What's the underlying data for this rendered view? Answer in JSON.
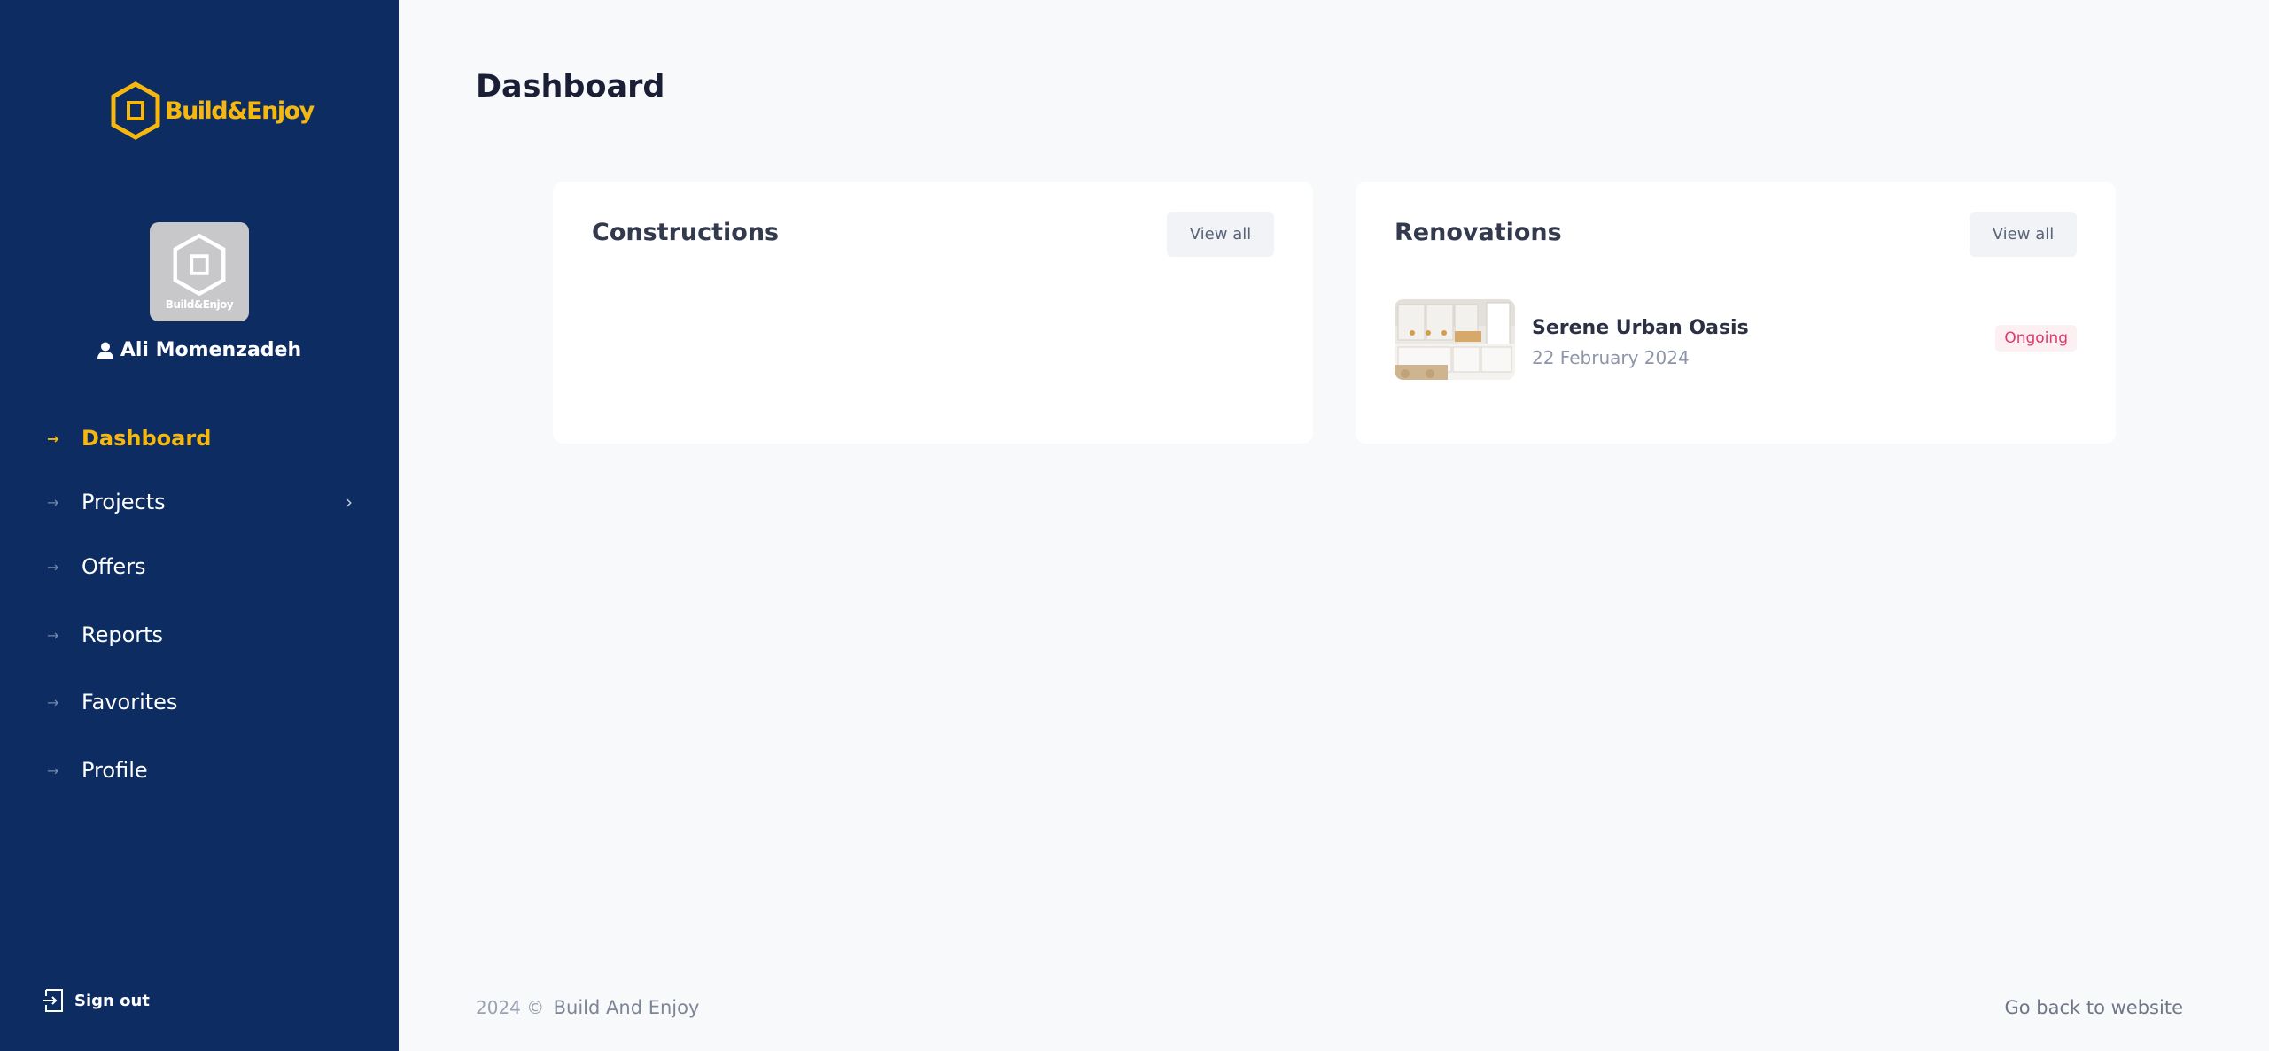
{
  "sidebar": {
    "logo_text": "Build&Enjoy",
    "avatar_text": "Build&Enjoy",
    "user_name": "Ali Momenzadeh",
    "items": [
      {
        "label": "Dashboard",
        "active": true
      },
      {
        "label": "Projects",
        "has_submenu": true
      },
      {
        "label": "Offers"
      },
      {
        "label": "Reports"
      },
      {
        "label": "Favorites"
      },
      {
        "label": "Profile"
      }
    ],
    "signout_label": "Sign out"
  },
  "main": {
    "title": "Dashboard",
    "cards": [
      {
        "title": "Constructions",
        "view_all": "View all",
        "items": []
      },
      {
        "title": "Renovations",
        "view_all": "View all",
        "items": [
          {
            "name": "Serene Urban Oasis",
            "date": "22 February 2024",
            "status": "Ongoing"
          }
        ]
      }
    ]
  },
  "footer": {
    "copyright": "2024 ©",
    "brand": "Build And Enjoy",
    "back_link": "Go back to website"
  },
  "colors": {
    "sidebar_bg": "#0d2c61",
    "accent": "#f6b80f",
    "badge_text": "#e0386b",
    "page_bg": "#f8f9fb"
  }
}
